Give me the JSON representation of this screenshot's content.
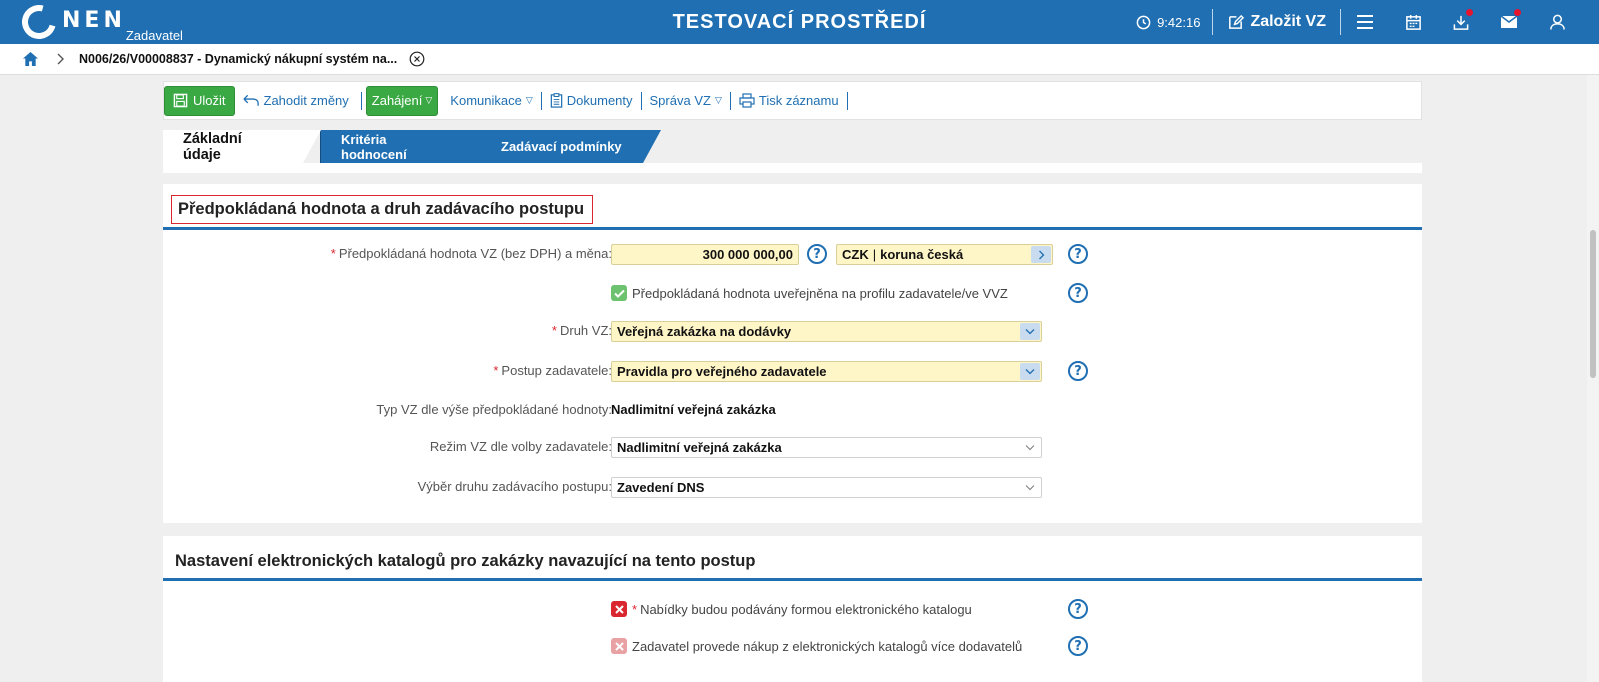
{
  "header": {
    "logo_text": "NEN",
    "logo_sub": "Zadavatel",
    "env_title": "TESTOVACÍ PROSTŘEDÍ",
    "clock": "9:42:16",
    "create_label": "Založit VZ",
    "icons": [
      "menu-icon",
      "calendar-icon",
      "download-icon",
      "mail-icon",
      "user-icon"
    ]
  },
  "breadcrumb": {
    "current": "N006/26/V00008837 - Dynamický nákupní systém na..."
  },
  "toolbar": {
    "save": "Uložit",
    "discard": "Zahodit změny",
    "start": "Zahájení",
    "communication": "Komunikace",
    "documents": "Dokumenty",
    "management": "Správa VZ",
    "print": "Tisk záznamu"
  },
  "tabs": [
    {
      "label": "Základní údaje",
      "active": true
    },
    {
      "label": "Kritéria hodnocení",
      "active": false
    },
    {
      "label": "Zadávací podmínky",
      "active": false
    }
  ],
  "section1": {
    "title": "Předpokládaná hodnota a druh zadávacího postupu",
    "value_label": "Předpokládaná hodnota VZ (bez DPH) a měna:",
    "value": "300 000 000,00",
    "currency_code": "CZK",
    "currency_name": "koruna česká",
    "published_label": "Předpokládaná hodnota uveřejněna na profilu zadavatele/ve VVZ",
    "published_checked": true,
    "type_label": "Druh VZ:",
    "type_value": "Veřejná zakázka na dodávky",
    "procedure_label": "Postup zadavatele:",
    "procedure_value": "Pravidla pro veřejného zadavatele",
    "size_label": "Typ VZ dle výše předpokládané hodnoty:",
    "size_value": "Nadlimitní veřejná zakázka",
    "regime_label": "Režim VZ dle volby zadavatele:",
    "regime_value": "Nadlimitní veřejná zakázka",
    "choice_label": "Výběr druhu zadávacího postupu:",
    "choice_value": "Zavedení DNS"
  },
  "section2": {
    "title": "Nastavení elektronických katalogů pro zakázky navazující na tento postup",
    "opt1_label": "Nabídky budou podávány formou elektronického katalogu",
    "opt1_checked": false,
    "opt2_label": "Zadavatel provede nákup z elektronických katalogů více dodavatelů",
    "opt2_checked": false
  },
  "colors": {
    "brand_blue": "#1f6fb2",
    "save_green": "#3aa843",
    "required_red": "#d9262f",
    "field_yellow": "#fff6c8"
  }
}
